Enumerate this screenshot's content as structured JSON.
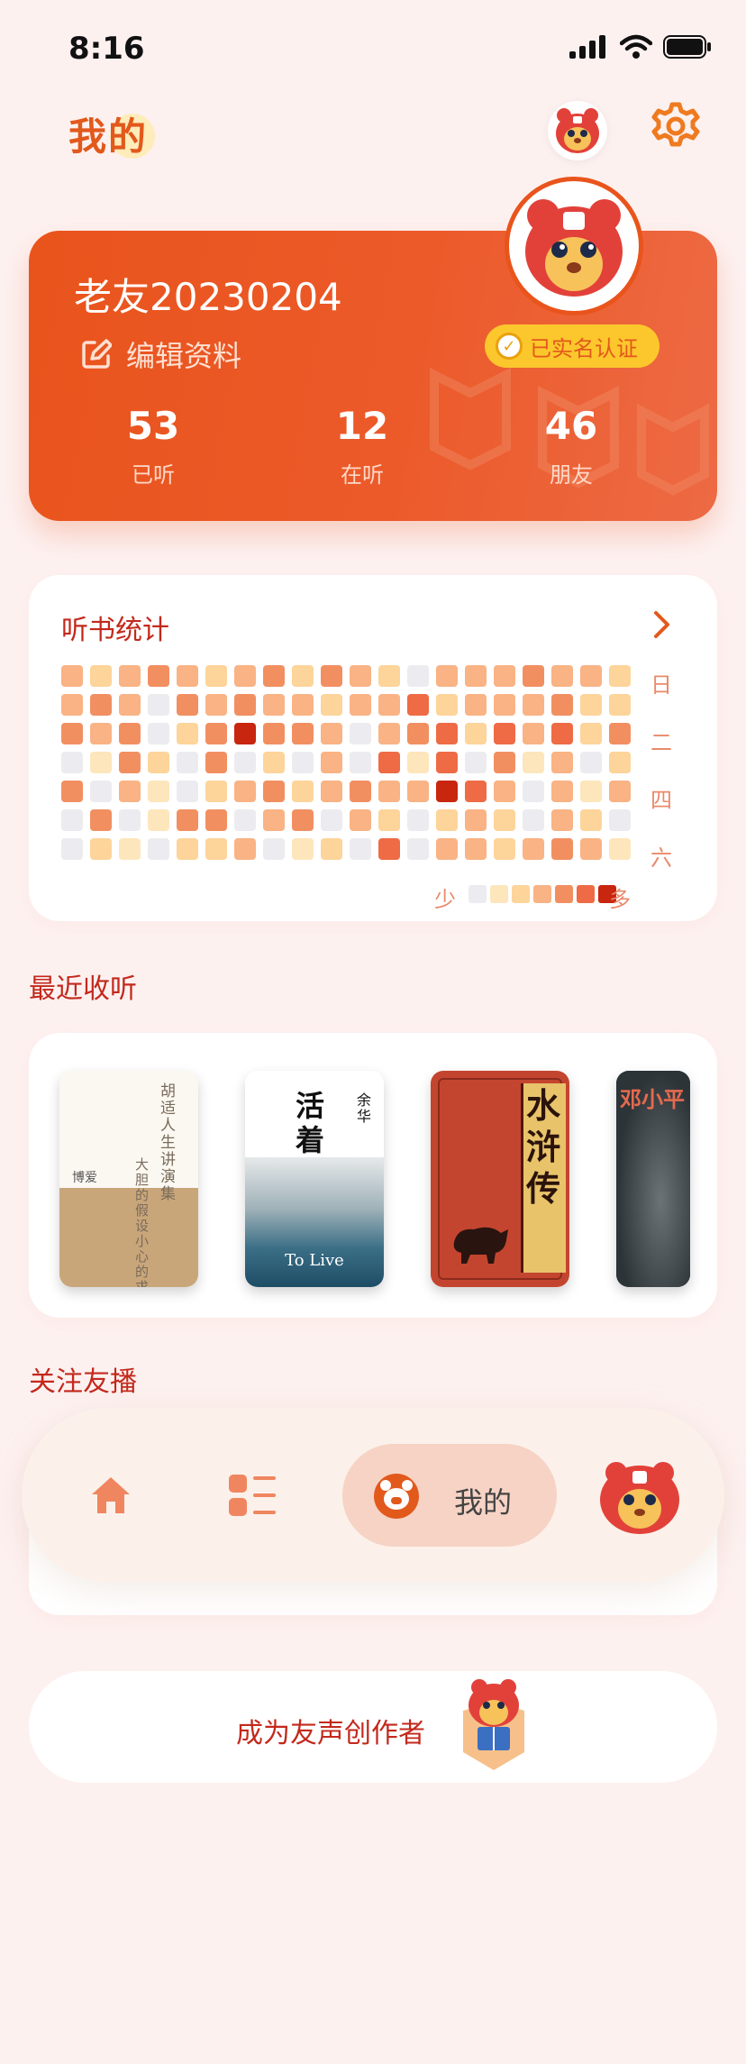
{
  "status_bar": {
    "time": "8:16"
  },
  "header": {
    "title": "我的",
    "avatar_icon": "bear-mascot-icon",
    "settings_icon": "gear-icon"
  },
  "profile": {
    "username": "老友20230204",
    "edit_label": "编辑资料",
    "verified_label": "已实名认证",
    "stats": [
      {
        "value": "53",
        "label": "已听"
      },
      {
        "value": "12",
        "label": "在听"
      },
      {
        "value": "46",
        "label": "朋友"
      }
    ]
  },
  "listening_stats": {
    "title": "听书统计",
    "weekdays": [
      "日",
      "二",
      "四",
      "六"
    ],
    "legend_less": "少",
    "legend_more": "多",
    "palette": [
      "#ececf0",
      "#fde6bb",
      "#fdd49a",
      "#f9b384",
      "#f28f61",
      "#ee6b45",
      "#c8260e"
    ],
    "levels": [
      [
        3,
        2,
        3,
        4,
        3,
        2,
        3,
        4,
        2,
        4,
        3,
        2,
        0,
        3,
        3,
        3,
        4,
        3,
        3,
        2
      ],
      [
        3,
        4,
        3,
        0,
        4,
        3,
        4,
        3,
        3,
        2,
        3,
        3,
        5,
        2,
        3,
        3,
        3,
        4,
        2,
        2
      ],
      [
        4,
        3,
        4,
        0,
        2,
        4,
        6,
        4,
        4,
        3,
        0,
        3,
        4,
        5,
        2,
        5,
        3,
        5,
        2,
        4
      ],
      [
        0,
        1,
        4,
        2,
        0,
        4,
        0,
        2,
        0,
        3,
        0,
        5,
        1,
        5,
        0,
        4,
        1,
        3,
        0,
        2
      ],
      [
        4,
        0,
        3,
        1,
        0,
        2,
        3,
        4,
        2,
        3,
        4,
        3,
        3,
        6,
        5,
        3,
        0,
        3,
        1,
        3
      ],
      [
        0,
        4,
        0,
        1,
        4,
        4,
        0,
        3,
        4,
        0,
        3,
        2,
        0,
        2,
        3,
        2,
        0,
        3,
        2,
        0
      ],
      [
        0,
        2,
        1,
        0,
        2,
        2,
        3,
        0,
        1,
        2,
        0,
        5,
        0,
        3,
        3,
        2,
        3,
        4,
        3,
        1
      ]
    ]
  },
  "recent": {
    "title": "最近收听",
    "books": [
      {
        "title_vertical": "胡适人生讲演集",
        "subtitle": "大胆的假设 小心的求证",
        "small": "博爱"
      },
      {
        "title_vertical": "活着",
        "author": "余华",
        "subtitle": "To Live"
      },
      {
        "title_vertical": "水浒传"
      },
      {
        "title_vertical": "邓小平"
      }
    ]
  },
  "follow": {
    "title": "关注友播"
  },
  "tabbar": {
    "items": [
      {
        "icon": "home-icon"
      },
      {
        "icon": "category-list-icon"
      },
      {
        "icon": "bear-face-icon",
        "label": "我的"
      },
      {
        "icon": "bear-mascot-icon"
      }
    ]
  },
  "creator": {
    "label": "成为友声创作者",
    "icon": "mascot-reading-icon"
  }
}
